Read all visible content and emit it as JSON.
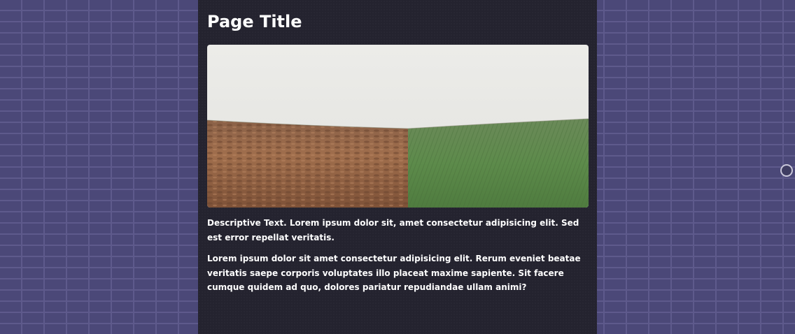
{
  "page": {
    "title": "Page Title",
    "paragraphs": [
      "Descriptive Text. Lorem ipsum dolor sit, amet consectetur adipisicing elit. Sed est error repellat veritatis.",
      "Lorem ipsum dolor sit amet consectetur adipisicing elit. Rerum eveniet beatae veritatis saepe corporis voluptates illo placeat maxime sapiente. Sit facere cumque quidem ad quo, dolores pariatur repudiandae ullam animi?"
    ]
  },
  "colors": {
    "background_brick": "#4b4878",
    "panel": "#24232f",
    "text": "#ffffff",
    "sky": "#e9e9e6",
    "soil": "#9a6a4a",
    "grass": "#5f8a4e"
  },
  "icons": {
    "hero_image": "landscape-field-image",
    "scroll_handle": "circle-handle-icon"
  }
}
